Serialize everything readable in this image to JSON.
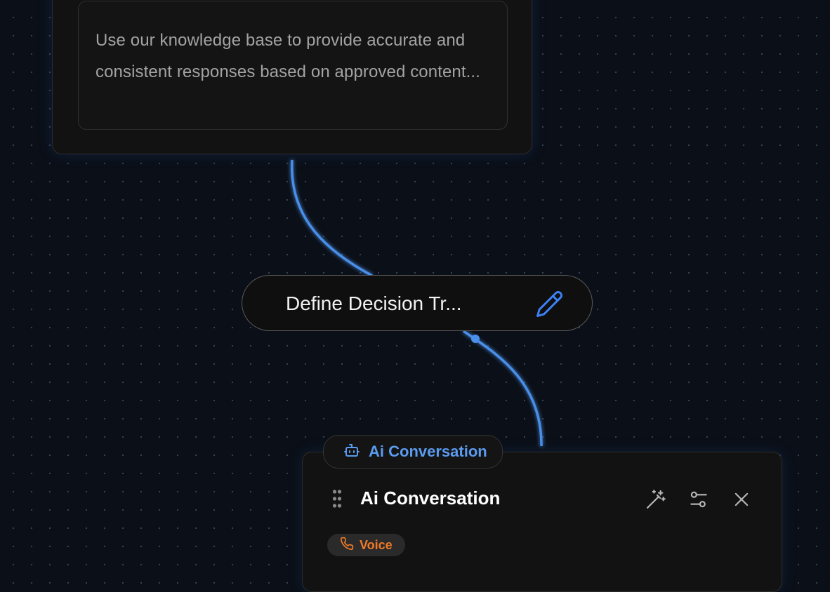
{
  "knowledge_node": {
    "description": "Use our knowledge base to provide accurate and consistent responses based on approved content..."
  },
  "decision_pill": {
    "label": "Define Decision Tr..."
  },
  "conversation_node": {
    "tab_label": "Ai Conversation",
    "title": "Ai Conversation",
    "badge_label": "Voice"
  },
  "colors": {
    "accent_blue": "#4a8fe8",
    "badge_orange": "#f07a28",
    "canvas_bg": "#0b0f17"
  },
  "icons": {
    "pill_edit": "pencil-icon",
    "tab": "bot-icon",
    "drag": "drag-handle-icon",
    "magic": "magic-wand-icon",
    "settings": "sliders-icon",
    "close": "close-icon",
    "badge": "phone-icon"
  }
}
